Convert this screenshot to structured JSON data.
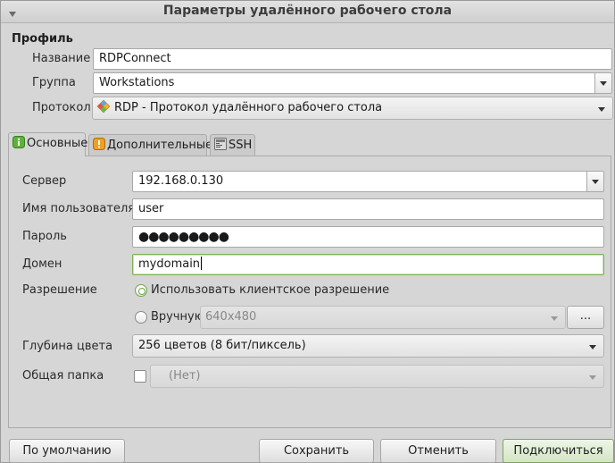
{
  "window": {
    "title": "Параметры удалённого рабочего стола"
  },
  "profile": {
    "section_title": "Профиль",
    "name_label": "Название",
    "name_value": "RDPConnect",
    "group_label": "Группа",
    "group_value": "Workstations",
    "protocol_label": "Протокол",
    "protocol_value": "RDP - Протокол удалённого рабочего стола"
  },
  "tabs": [
    {
      "label": "Основные",
      "icon": "info-icon",
      "active": true
    },
    {
      "label": "Дополнительные",
      "icon": "warning-icon",
      "active": false
    },
    {
      "label": "SSH",
      "icon": "terminal-icon",
      "active": false
    }
  ],
  "basic": {
    "server_label": "Сервер",
    "server_value": "192.168.0.130",
    "username_label": "Имя пользователя",
    "username_value": "user",
    "password_label": "Пароль",
    "password_mask": "●●●●●●●●●",
    "domain_label": "Домен",
    "domain_value": "mydomain",
    "resolution_label": "Разрешение",
    "resolution_client_option": "Использовать клиентское разрешение",
    "resolution_manual_option": "Вручную",
    "resolution_manual_value": "640x480",
    "resolution_more": "...",
    "color_depth_label": "Глубина цвета",
    "color_depth_value": "256 цветов (8 бит/пиксель)",
    "shared_folder_label": "Общая папка",
    "shared_folder_value": "(Нет)"
  },
  "buttons": {
    "default": "По умолчанию",
    "save": "Сохранить",
    "cancel": "Отменить",
    "connect": "Подключиться"
  },
  "colors": {
    "accent": "#7fb35a",
    "background": "#d6d6d6"
  }
}
